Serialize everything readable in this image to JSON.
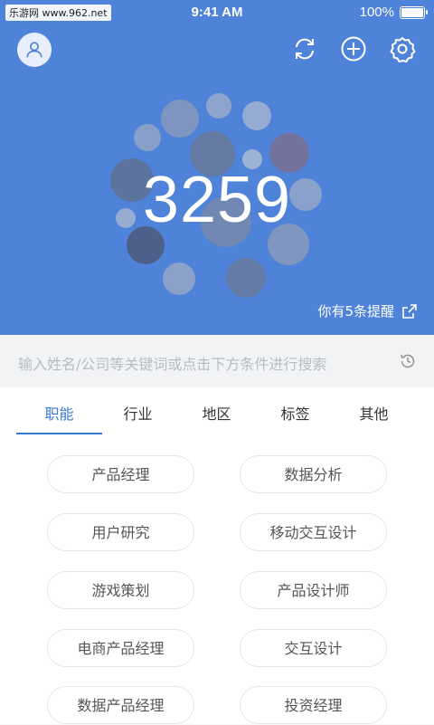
{
  "status_bar": {
    "watermark": "乐游网 www.962.net",
    "time": "9:41 AM",
    "battery": "100%"
  },
  "hero": {
    "count": "3259",
    "reminder": "你有5条提醒",
    "colors": {
      "background": "#4f82d9",
      "accent": "#3a78d8"
    }
  },
  "search": {
    "placeholder": "输入姓名/公司等关键词或点击下方条件进行搜索"
  },
  "tabs": [
    "职能",
    "行业",
    "地区",
    "标签",
    "其他"
  ],
  "active_tab": "职能",
  "tags": [
    "产品经理",
    "数据分析",
    "用户研究",
    "移动交互设计",
    "游戏策划",
    "产品设计师",
    "电商产品经理",
    "交互设计",
    "数据产品经理",
    "投资经理"
  ],
  "icons": {
    "profile": "person-icon",
    "refresh": "refresh-icon",
    "add": "plus-icon",
    "settings": "gear-icon",
    "external": "arrow-out-icon",
    "history": "clock-icon"
  }
}
